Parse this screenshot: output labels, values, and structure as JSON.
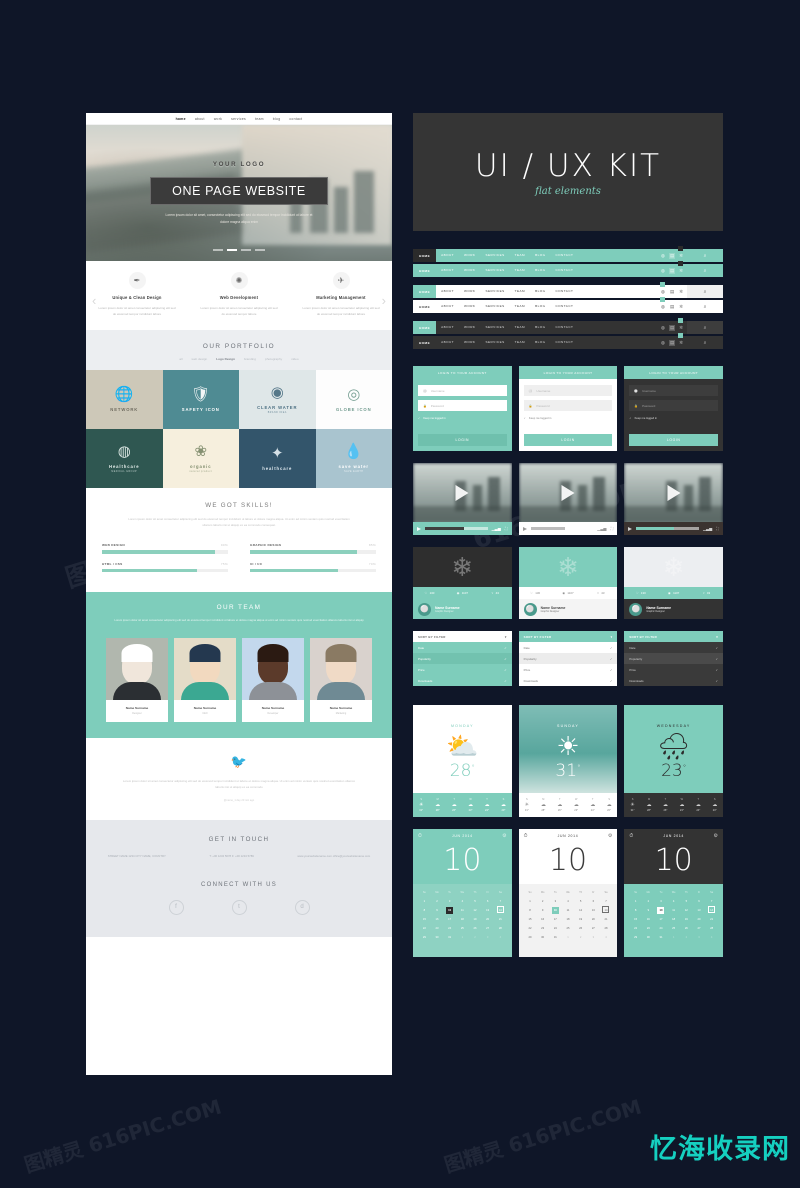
{
  "watermarks": {
    "diagonal": "图精灵 616PIC.COM",
    "brand": "忆海收录网"
  },
  "kit_header": {
    "title": "UI / UX KIT",
    "subtitle": "flat elements"
  },
  "onepage": {
    "nav": [
      "home",
      "about",
      "work",
      "services",
      "team",
      "blog",
      "contact"
    ],
    "hero": {
      "logo": "YOUR LOGO",
      "banner": "ONE PAGE WEBSITE",
      "subtext": "Lorem ipsum dolor sit amet, consectetur adipiscing elit sed do eiusmod tempor incididunt ut labore et dolore magna aliqua enim"
    },
    "features": [
      {
        "icon": "pen-icon",
        "glyph": "✒",
        "title": "Unique & Clean Design",
        "text": "Lorem ipsum dolor sit amet consectetur adipiscing elit sed do eiusmod tempor incididunt labore"
      },
      {
        "icon": "globe-icon",
        "glyph": "✺",
        "title": "Web Development",
        "text": "Lorem ipsum dolor sit amet consectetur adipiscing elit sed do eiusmod tempor labore"
      },
      {
        "icon": "rocket-icon",
        "glyph": "🚀",
        "title": "Marketing Management",
        "text": "Lorem ipsum dolor sit amet consectetur adipiscing elit sed do eiusmod tempor incididunt labore"
      }
    ],
    "portfolio": {
      "title": "OUR PORTFOLIO",
      "filters": [
        "all",
        "web design",
        "Logo Design",
        "branding",
        "photography",
        "video"
      ],
      "active_filter": "Logo Design",
      "items": [
        {
          "label": "NETWORK",
          "sub": "",
          "glyph": "🌐",
          "bg": "#cdc8b8",
          "fg": "#6f6b5f"
        },
        {
          "label": "SAFETY ICON",
          "sub": "",
          "glyph": "🛡",
          "bg": "#4f8b93",
          "fg": "#ffffff"
        },
        {
          "label": "CLEAR WATER",
          "sub": "BRAND IDEA",
          "glyph": "◉",
          "bg": "#dfe7e8",
          "fg": "#4b6f82"
        },
        {
          "label": "GLOBE ICON",
          "sub": "",
          "glyph": "◎",
          "bg": "#fdfdfd",
          "fg": "#6f9a8d"
        },
        {
          "label": "Healthcare",
          "sub": "MEDICAL GROUP",
          "glyph": "◍",
          "bg": "#2f5751",
          "fg": "#e6efec"
        },
        {
          "label": "organic",
          "sub": "natural product",
          "glyph": "❀",
          "bg": "#f6efdd",
          "fg": "#7d8a6a"
        },
        {
          "label": "healthcare",
          "sub": "",
          "glyph": "✦",
          "bg": "#33556b",
          "fg": "#e3ecf2"
        },
        {
          "label": "save water",
          "sub": "SAVE EARTH",
          "glyph": "💧",
          "bg": "#a9c4cf",
          "fg": "#ffffff"
        }
      ]
    },
    "skills": {
      "title": "WE GOT SKILLS!",
      "text": "Lorem ipsum dolor sit amet consectetur adipiscing elit sed do eiusmod tempor incididunt ut labore et dolore magna aliqua. Ut enim ad minim veniam quis nostrud exercitation ullamco laboris nisi ut aliquip ex ea commodo consequat.",
      "bars": [
        {
          "label": "WEB DESIGN",
          "pct": 90
        },
        {
          "label": "GRAPHIC DESIGN",
          "pct": 85
        },
        {
          "label": "HTML / CSS",
          "pct": 75
        },
        {
          "label": "UI / UX",
          "pct": 70
        }
      ]
    },
    "team": {
      "title": "OUR TEAM",
      "text": "Lorem ipsum dolor sit amet consectetur adipiscing elit sed do eiusmod tempor incididunt ut labore et dolore magna aliqua ut enim ad minim veniam quis nostrud exercitation ullamco laboris nisi ut aliquip",
      "members": [
        {
          "name": "Name Surname",
          "role": "Designer",
          "bg": "#b1b7ae"
        },
        {
          "name": "Name Surname",
          "role": "CEO",
          "bg": "#e4dcc8"
        },
        {
          "name": "Name Surname",
          "role": "Developer",
          "bg": "#c3d8ed"
        },
        {
          "name": "Name Surname",
          "role": "Marketing",
          "bg": "#d9d2cd"
        }
      ]
    },
    "twitter": {
      "icon": "twitter-bird-icon",
      "text": "Lorem ipsum dolor sit amet consectetur adipiscing elit sed do eiusmod tempor incididunt ut labore et dolore magna aliqua. Ut enim ad minim veniam quis nostrud exercitation ullamco laboris nisi ut aliquip ex ea commodo",
      "handle": "@name_1 day 20 min ago"
    },
    "contact": {
      "title": "GET IN TOUCH",
      "columns": [
        "STREET NAME 1234\nCITY NAME, COUNTRY",
        "T: +00 1234 5678\nF: +00 1234 5789",
        "www.yourwebsitename.com\noffice@yourwebsitename.com"
      ],
      "connect_title": "CONNECT WITH US",
      "socials": [
        {
          "name": "facebook-icon",
          "glyph": "f"
        },
        {
          "name": "twitter-icon",
          "glyph": "t"
        },
        {
          "name": "dribbble-icon",
          "glyph": "d"
        }
      ]
    }
  },
  "navbars": {
    "items": [
      "HOME",
      "ABOUT",
      "WORK",
      "SERVICES",
      "TEAM",
      "BLOG",
      "CONTACT"
    ],
    "icons": [
      "globe-icon",
      "cart-icon",
      "gear-icon"
    ],
    "search_icon": "search-icon",
    "variants": [
      {
        "style": "teal-dark-home",
        "bg": "#7ecdbb",
        "text": "#ffffff",
        "home_bg": "#2b2b2b",
        "home_text": "#ffffff",
        "search_bg": "#7ecdbb"
      },
      {
        "style": "teal-flat",
        "bg": "#7ecdbb",
        "text": "#ffffff",
        "home_bg": "#7ecdbb",
        "home_text": "#ffffff",
        "search_bg": "#7ecdbb"
      },
      {
        "style": "white-teal-home",
        "bg": "#ffffff",
        "text": "#4a4a4a",
        "home_bg": "#7ecdbb",
        "home_text": "#ffffff",
        "search_bg": "#f0f0f0"
      },
      {
        "style": "white-flat",
        "bg": "#ffffff",
        "text": "#4a4a4a",
        "home_bg": "#ffffff",
        "home_text": "#4a4a4a",
        "search_bg": "#ffffff"
      },
      {
        "style": "dark-teal-home",
        "bg": "#333333",
        "text": "#d8d8d8",
        "home_bg": "#7ecdbb",
        "home_text": "#ffffff",
        "search_bg": "#3d3d3d"
      },
      {
        "style": "dark-flat",
        "bg": "#333333",
        "text": "#d8d8d8",
        "home_bg": "#333333",
        "home_text": "#ffffff",
        "search_bg": "#333333"
      }
    ]
  },
  "login_cards": [
    {
      "theme": "teal",
      "header": "LOGIN TO YOUR ACCOUNT",
      "username_placeholder": "Username",
      "password_placeholder": "Password",
      "remember_label": "Keep me logged in",
      "button": "LOGIN",
      "bg": "#7ecdbb",
      "field_bg": "#ffffff",
      "field_text": "#b9b9b9",
      "btn_bg": "#6fc0ad",
      "btn_text": "#ffffff",
      "label_color": "#ffffff"
    },
    {
      "theme": "white",
      "header": "LOGIN TO YOUR ACCOUNT",
      "username_placeholder": "Username",
      "password_placeholder": "Password",
      "remember_label": "Keep me logged in",
      "button": "LOGIN",
      "bg": "#ffffff",
      "field_bg": "#efefef",
      "field_text": "#b9b9b9",
      "btn_bg": "#7ecdbb",
      "btn_text": "#ffffff",
      "label_color": "#8a8a8a"
    },
    {
      "theme": "dark",
      "header": "LOGIN TO YOUR ACCOUNT",
      "username_placeholder": "Username",
      "password_placeholder": "Password",
      "remember_label": "Keep me logged in",
      "button": "LOGIN",
      "bg": "#333333",
      "field_bg": "#3d3d3d",
      "field_text": "#9a9a9a",
      "btn_bg": "#7ecdbb",
      "btn_text": "#ffffff",
      "label_color": "#dddddd"
    }
  ],
  "video_players": [
    {
      "theme": "teal",
      "bar_bg": "#7ecdbb",
      "bar_fg": "#ffffff",
      "fill": "#3f3f3f",
      "progress": 62
    },
    {
      "theme": "white",
      "bar_bg": "#ffffff",
      "bar_fg": "#9a9a9a",
      "fill": "#bcbcbc",
      "progress": 55
    },
    {
      "theme": "dark",
      "bar_bg": "#3b3330",
      "bar_fg": "#cfcfcf",
      "fill": "#7ecdbb",
      "progress": 60
    }
  ],
  "profile_cards": [
    {
      "theme": "dark",
      "name": "Name Surname",
      "role": "Graphic Designer",
      "likes": "130",
      "views": "1107",
      "comments": "43",
      "img_bg": "#2e2e2e",
      "stats_bg": "#7ecdbb",
      "stats_text": "#ffffff",
      "foot_bg": "#7ecdbb",
      "foot_text": "#ffffff"
    },
    {
      "theme": "teal",
      "name": "Name Surname",
      "role": "Graphic Designer",
      "likes": "130",
      "views": "1107",
      "comments": "43",
      "img_bg": "#7ecdbb",
      "stats_bg": "#ffffff",
      "stats_text": "#8a8a8a",
      "foot_bg": "#f4f4f4",
      "foot_text": "#4a4a4a"
    },
    {
      "theme": "light",
      "name": "Name Surname",
      "role": "Graphic Designer",
      "likes": "130",
      "views": "1107",
      "comments": "43",
      "img_bg": "#eceef1",
      "stats_bg": "#7ecdbb",
      "stats_text": "#ffffff",
      "foot_bg": "#333333",
      "foot_text": "#ffffff"
    }
  ],
  "dropdowns": [
    {
      "theme": "teal",
      "header": "SORT BY FILTER",
      "options": [
        "Date",
        "Popularity",
        "Price",
        "Downloads"
      ],
      "selected": "Popularity",
      "head_bg": "#ffffff",
      "head_text": "#6a6a6a",
      "body_bg": "#7ecdbb",
      "opt_text": "#ffffff",
      "sel_bg": "#72c2af"
    },
    {
      "theme": "white",
      "header": "SORT BY FILTER",
      "options": [
        "Date",
        "Popularity",
        "Price",
        "Downloads"
      ],
      "selected": "Popularity",
      "head_bg": "#7ecdbb",
      "head_text": "#ffffff",
      "body_bg": "#ffffff",
      "opt_text": "#7a7a7a",
      "sel_bg": "#ececec"
    },
    {
      "theme": "dark",
      "header": "SORT BY FILTER",
      "options": [
        "Date",
        "Popularity",
        "Price",
        "Downloads"
      ],
      "selected": "Popularity",
      "head_bg": "#7ecdbb",
      "head_text": "#ffffff",
      "body_bg": "#3a3a3a",
      "opt_text": "#cfcfcf",
      "sel_bg": "#4a4a4a"
    }
  ],
  "weather_cards": [
    {
      "theme": "white",
      "day": "MONDAY",
      "temp": "28",
      "unit": "°",
      "icon": "sun-cloud-icon",
      "glyph": "⛅",
      "top_bg": "#ffffff",
      "top_text": "#7ecdbb",
      "fc_bg": "#7ecdbb",
      "fc_text": "#ffffff",
      "forecast": [
        {
          "d": "S",
          "i": "☀",
          "t": "31°"
        },
        {
          "d": "M",
          "i": "☁",
          "t": "28°"
        },
        {
          "d": "T",
          "i": "☁",
          "t": "26°"
        },
        {
          "d": "W",
          "i": "☁",
          "t": "23°"
        },
        {
          "d": "T",
          "i": "☁",
          "t": "24°"
        },
        {
          "d": "S",
          "i": "☁",
          "t": "20°"
        }
      ]
    },
    {
      "theme": "photo",
      "day": "SUNDAY",
      "temp": "31",
      "unit": "°",
      "icon": "sun-icon",
      "glyph": "☀",
      "top_bg": "#5fa8a0",
      "top_text": "#ffffff",
      "fc_bg": "#ffffff",
      "fc_text": "#8a8a8a",
      "forecast": [
        {
          "d": "S",
          "i": "☀",
          "t": "31°"
        },
        {
          "d": "M",
          "i": "☁",
          "t": "28°"
        },
        {
          "d": "T",
          "i": "☁",
          "t": "26°"
        },
        {
          "d": "W",
          "i": "☁",
          "t": "23°"
        },
        {
          "d": "T",
          "i": "☁",
          "t": "24°"
        },
        {
          "d": "S",
          "i": "☁",
          "t": "20°"
        }
      ]
    },
    {
      "theme": "teal",
      "day": "WEDNESDAY",
      "temp": "23",
      "unit": "°",
      "icon": "rain-cloud-icon",
      "glyph": "🌧",
      "top_bg": "#7ecdbb",
      "top_text": "#2b2b2b",
      "fc_bg": "#333333",
      "fc_text": "#d0d0d0",
      "forecast": [
        {
          "d": "S",
          "i": "☀",
          "t": "31°"
        },
        {
          "d": "M",
          "i": "☁",
          "t": "28°"
        },
        {
          "d": "T",
          "i": "☁",
          "t": "26°"
        },
        {
          "d": "W",
          "i": "☁",
          "t": "23°"
        },
        {
          "d": "T",
          "i": "☁",
          "t": "24°"
        },
        {
          "d": "S",
          "i": "☁",
          "t": "20°"
        }
      ]
    }
  ],
  "calendars": [
    {
      "theme": "teal",
      "month": "JUN 2014",
      "day": "10",
      "weekdays": [
        "Su",
        "Mo",
        "Tu",
        "We",
        "Th",
        "Fr",
        "Sa"
      ],
      "top_bg": "#7ecdbb",
      "top_text": "#ffffff",
      "grid_bg": "#8ed2c2",
      "grid_text": "#ffffff",
      "sel_bg": "#2b2b2b",
      "sel_text": "#ffffff",
      "weeks": [
        [
          "1",
          "2",
          "3",
          "4",
          "5",
          "6",
          "7"
        ],
        [
          "8",
          "9",
          "10",
          "11",
          "12",
          "13",
          "14"
        ],
        [
          "15",
          "16",
          "17",
          "18",
          "19",
          "20",
          "21"
        ],
        [
          "22",
          "23",
          "24",
          "25",
          "26",
          "27",
          "28"
        ],
        [
          "29",
          "30",
          "31",
          "1",
          "2",
          "3",
          "4"
        ]
      ],
      "muted_last": 4,
      "selected_day": "10",
      "boxed_day": "14"
    },
    {
      "theme": "white",
      "month": "JUN 2014",
      "day": "10",
      "weekdays": [
        "Su",
        "Mo",
        "Tu",
        "We",
        "Th",
        "Fr",
        "Sa"
      ],
      "top_bg": "#ffffff",
      "top_text": "#3b3b3b",
      "grid_bg": "#f2f2f2",
      "grid_text": "#6f6f6f",
      "sel_bg": "#7ecdbb",
      "sel_text": "#ffffff",
      "weeks": [
        [
          "1",
          "2",
          "3",
          "4",
          "5",
          "6",
          "7"
        ],
        [
          "8",
          "9",
          "10",
          "11",
          "12",
          "13",
          "14"
        ],
        [
          "15",
          "16",
          "17",
          "18",
          "19",
          "20",
          "21"
        ],
        [
          "22",
          "23",
          "24",
          "25",
          "26",
          "27",
          "28"
        ],
        [
          "29",
          "30",
          "31",
          "1",
          "2",
          "3",
          "4"
        ]
      ],
      "muted_last": 4,
      "selected_day": "10",
      "boxed_day": "14"
    },
    {
      "theme": "dark",
      "month": "JUN 2014",
      "day": "10",
      "weekdays": [
        "Su",
        "Mo",
        "Tu",
        "We",
        "Th",
        "Fr",
        "Sa"
      ],
      "top_bg": "#333333",
      "top_text": "#ffffff",
      "grid_bg": "#7ecdbb",
      "grid_text": "#ffffff",
      "sel_bg": "#ffffff",
      "sel_text": "#2b2b2b",
      "weeks": [
        [
          "1",
          "2",
          "3",
          "4",
          "5",
          "6",
          "7"
        ],
        [
          "8",
          "9",
          "10",
          "11",
          "12",
          "13",
          "14"
        ],
        [
          "15",
          "16",
          "17",
          "18",
          "19",
          "20",
          "21"
        ],
        [
          "22",
          "23",
          "24",
          "25",
          "26",
          "27",
          "28"
        ],
        [
          "29",
          "30",
          "31",
          "1",
          "2",
          "3",
          "4"
        ]
      ],
      "muted_last": 4,
      "selected_day": "10",
      "boxed_day": "14"
    }
  ]
}
